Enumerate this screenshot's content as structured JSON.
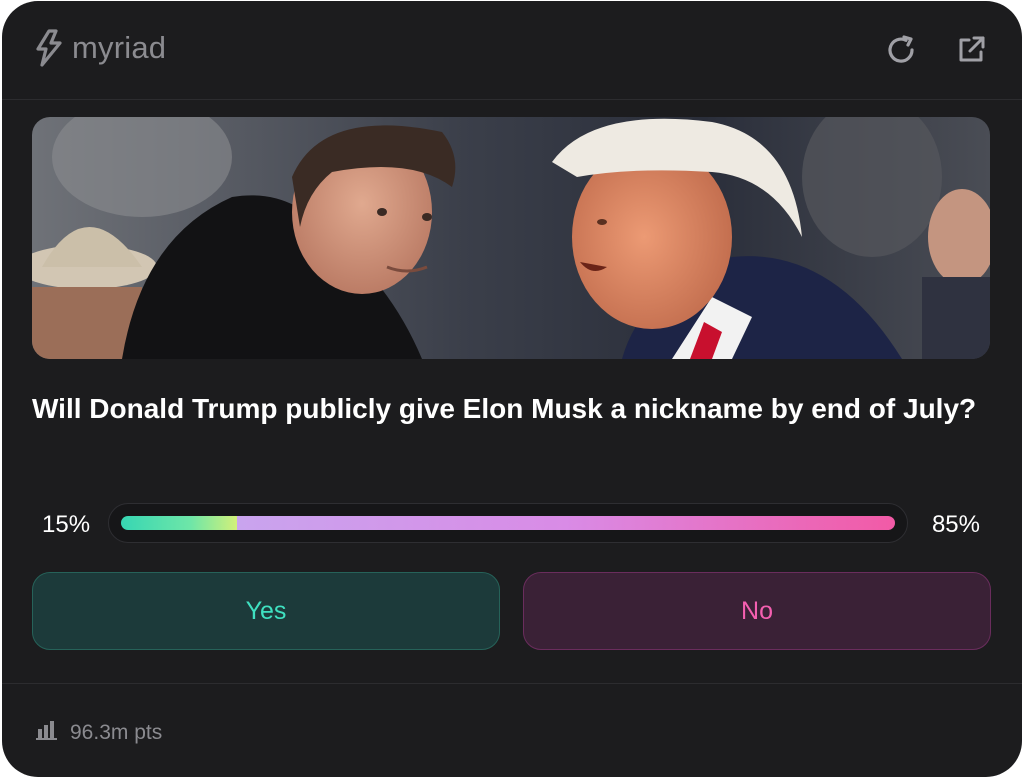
{
  "brand": {
    "name": "myriad",
    "logo_icon": "bolt-logo-icon"
  },
  "header": {
    "actions": [
      {
        "name": "refresh-icon"
      },
      {
        "name": "external-link-icon"
      }
    ]
  },
  "hero_image": {
    "subject_icon": "market-image"
  },
  "market": {
    "question": "Will Donald Trump publicly give Elon Musk a nickname by end of July?",
    "yes_pct_label": "15%",
    "no_pct_label": "85%",
    "yes_fraction": 0.15,
    "no_fraction": 0.85
  },
  "actions": {
    "yes_label": "Yes",
    "no_label": "No"
  },
  "footer": {
    "stats_icon": "bar-chart-icon",
    "points": "96.3m pts"
  },
  "colors": {
    "background": "#1c1c1e",
    "yes_accent": "#3fe0c0",
    "no_accent": "#f45fb0",
    "muted_text": "#8b8b90"
  }
}
